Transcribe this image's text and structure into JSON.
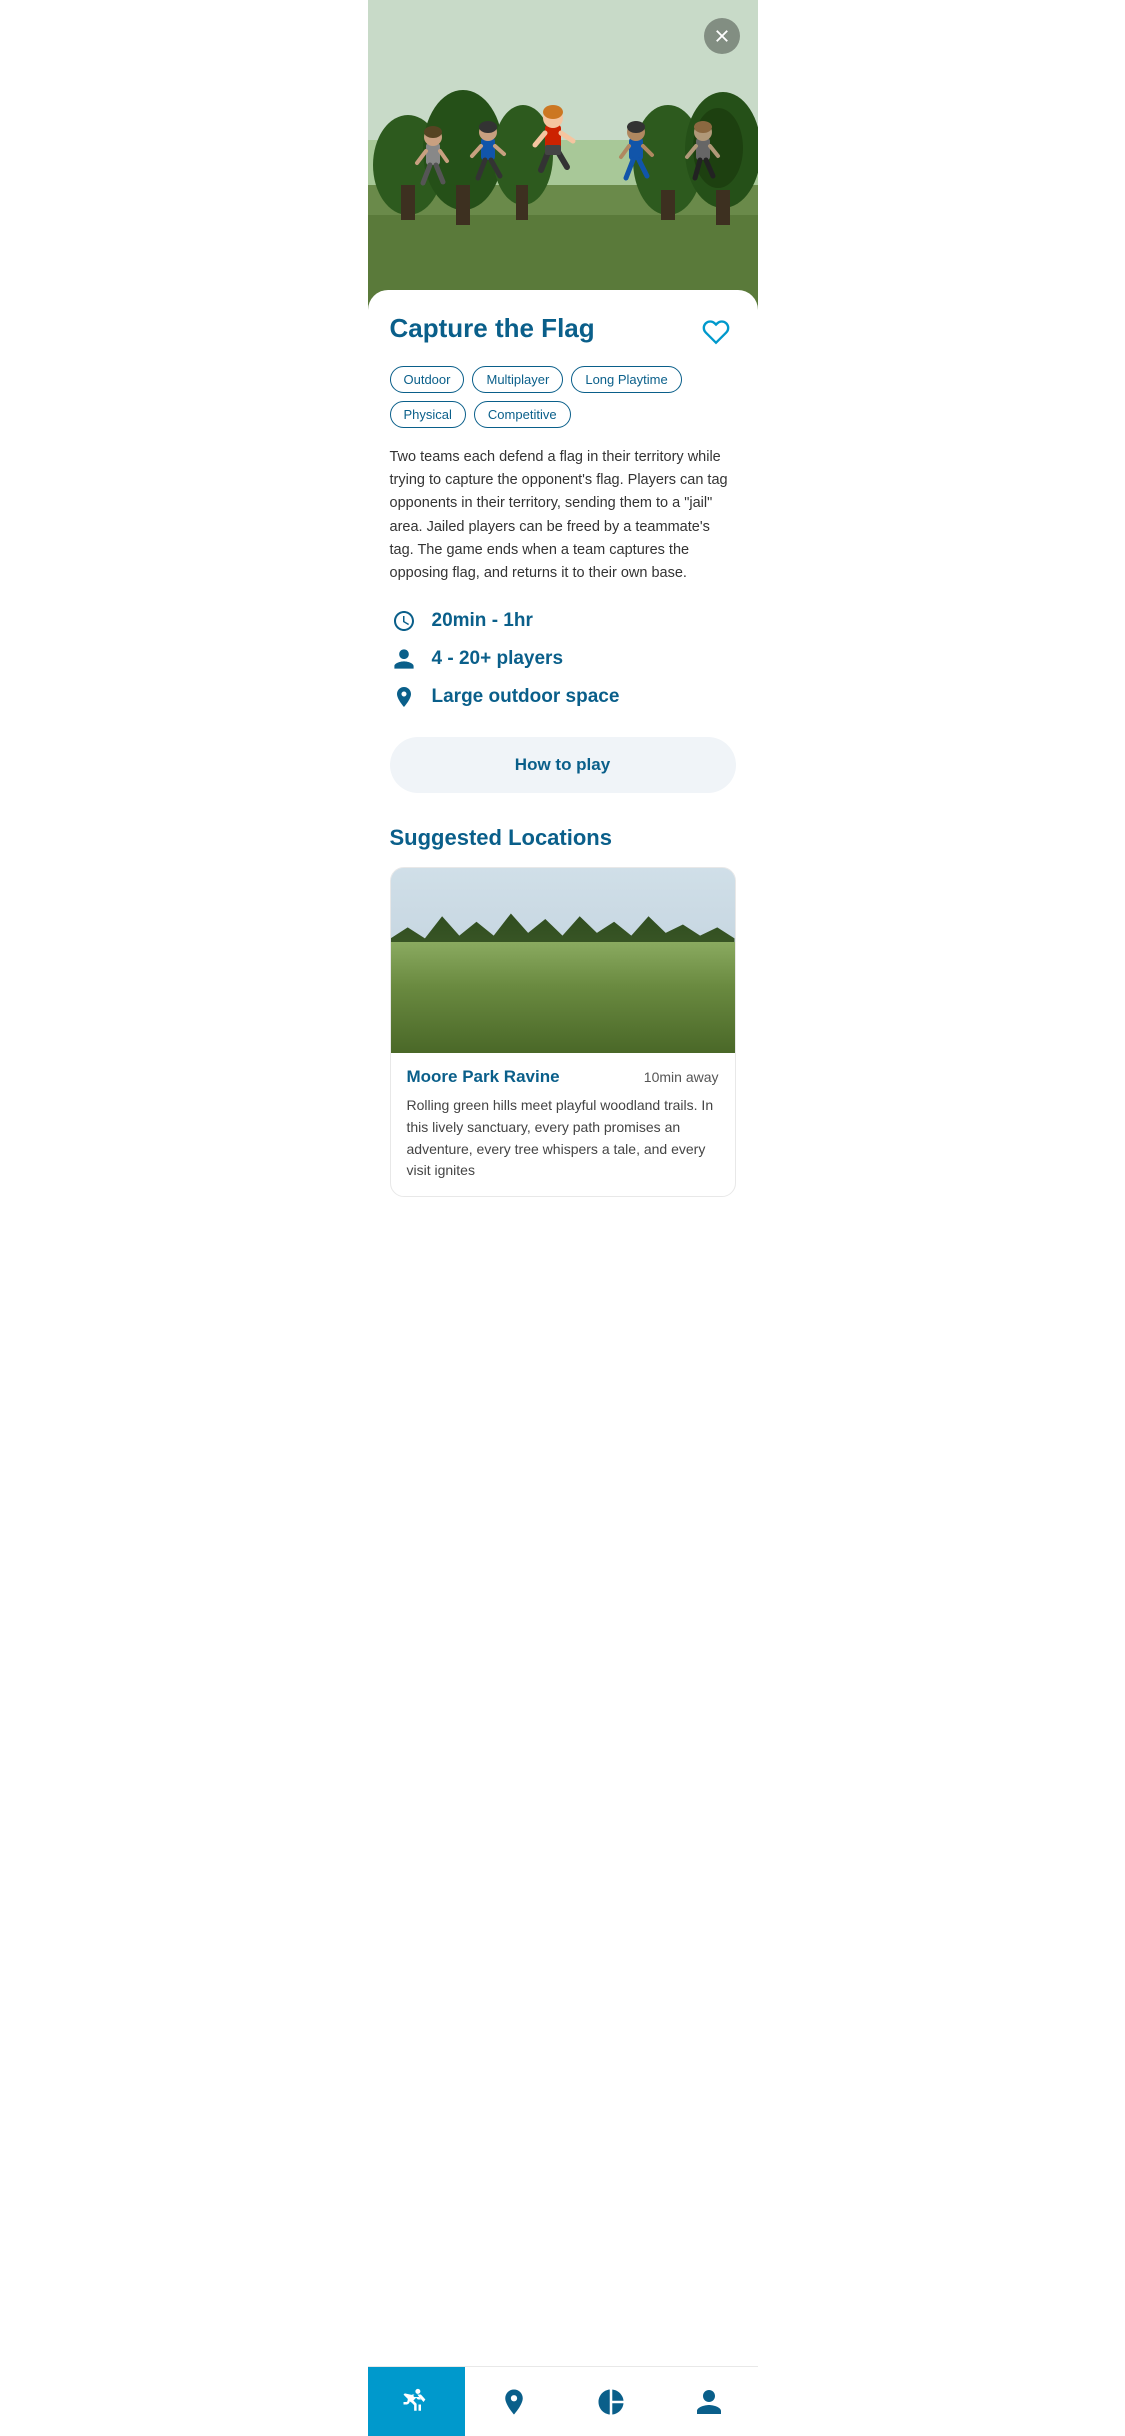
{
  "hero": {
    "close_label": "Close"
  },
  "game": {
    "title": "Capture the Flag",
    "tags": [
      "Outdoor",
      "Multiplayer",
      "Long Playtime",
      "Physical",
      "Competitive"
    ],
    "description": "Two teams each defend a flag in their territory while trying to capture the opponent's flag. Players can tag opponents in their territory, sending them to a \"jail\" area. Jailed players can be freed by a teammate's tag. The game ends when a team captures the opposing flag, and returns it to their own base.",
    "duration": "20min - 1hr",
    "players": "4 - 20+ players",
    "space": "Large outdoor space",
    "how_to_play_label": "How to play"
  },
  "suggested_locations": {
    "title": "Suggested Locations",
    "items": [
      {
        "name": "Moore Park Ravine",
        "distance": "10min away",
        "description": "Rolling green hills meet playful woodland trails. In this lively sanctuary, every path promises an adventure, every tree whispers a tale, and every visit ignites"
      }
    ]
  },
  "bottom_nav": {
    "items": [
      {
        "icon": "run-icon",
        "label": "Play",
        "active": true
      },
      {
        "icon": "location-icon",
        "label": "Map",
        "active": false
      },
      {
        "icon": "chart-icon",
        "label": "Stats",
        "active": false
      },
      {
        "icon": "profile-icon",
        "label": "Profile",
        "active": false
      }
    ]
  }
}
